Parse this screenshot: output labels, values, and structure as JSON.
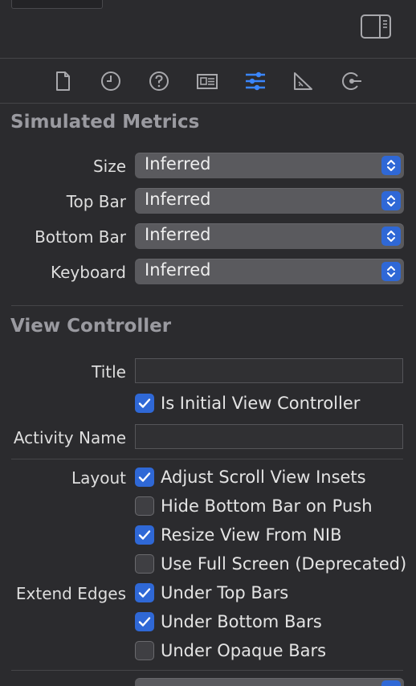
{
  "toolbar": {
    "tabs": [
      {
        "icon": "file-icon",
        "active": false
      },
      {
        "icon": "history-icon",
        "active": false
      },
      {
        "icon": "help-icon",
        "active": false
      },
      {
        "icon": "identity-icon",
        "active": false
      },
      {
        "icon": "attributes-icon",
        "active": true
      },
      {
        "icon": "size-icon",
        "active": false
      },
      {
        "icon": "connections-icon",
        "active": false
      }
    ],
    "accent_color": "#3a86ff"
  },
  "simulated_metrics": {
    "title": "Simulated Metrics",
    "size": {
      "label": "Size",
      "value": "Inferred"
    },
    "top_bar": {
      "label": "Top Bar",
      "value": "Inferred"
    },
    "bottom_bar": {
      "label": "Bottom Bar",
      "value": "Inferred"
    },
    "keyboard": {
      "label": "Keyboard",
      "value": "Inferred"
    }
  },
  "view_controller": {
    "title": "View Controller",
    "title_field": {
      "label": "Title",
      "value": ""
    },
    "is_initial": {
      "label": "Is Initial View Controller",
      "checked": true
    },
    "activity_name": {
      "label": "Activity Name",
      "value": ""
    },
    "layout_label": "Layout",
    "adjust_scroll": {
      "label": "Adjust Scroll View Insets",
      "checked": true
    },
    "hide_bottom_bar": {
      "label": "Hide Bottom Bar on Push",
      "checked": false
    },
    "resize_from_nib": {
      "label": "Resize View From NIB",
      "checked": true
    },
    "full_screen": {
      "label": "Use Full Screen (Deprecated)",
      "checked": false
    },
    "extend_edges_label": "Extend Edges",
    "under_top_bars": {
      "label": "Under Top Bars",
      "checked": true
    },
    "under_bottom_bars": {
      "label": "Under Bottom Bars",
      "checked": true
    },
    "under_opaque_bars": {
      "label": "Under Opaque Bars",
      "checked": false
    }
  },
  "colors": {
    "background": "#2b2b2e",
    "popup": "#5a5a5e",
    "checkbox_on": "#2f68d6"
  }
}
